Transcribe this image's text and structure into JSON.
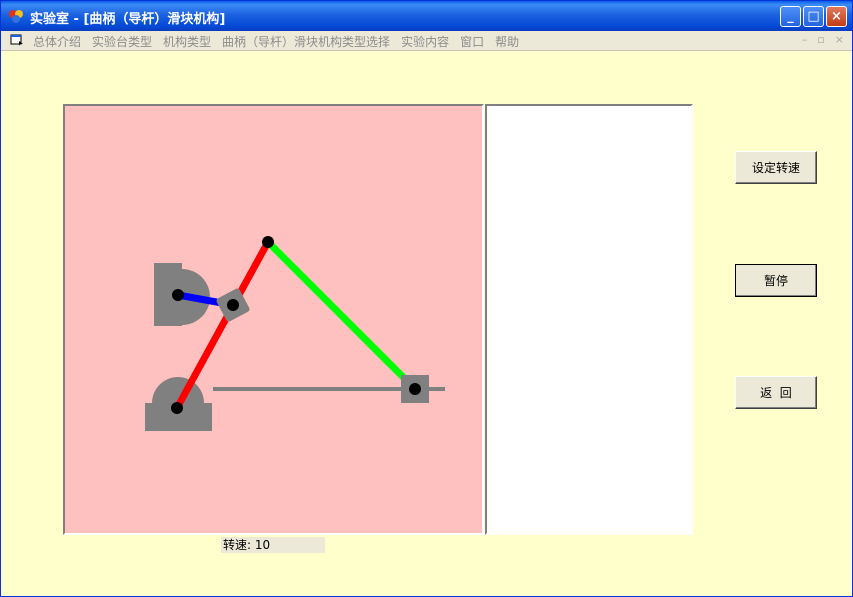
{
  "window": {
    "title": "实验室 - [曲柄（导杆）滑块机构]",
    "controls": {
      "minimize": "_",
      "maximize": "□",
      "close": "×"
    }
  },
  "menubar": {
    "items": [
      "总体介绍",
      "实验台类型",
      "机构类型",
      "曲柄（导杆）滑块机构类型选择",
      "实验内容",
      "窗口",
      "帮助"
    ],
    "mdi_controls": [
      "–",
      "▫",
      "×"
    ]
  },
  "status": {
    "speed_label": "转速: 10"
  },
  "buttons": {
    "set_speed": "设定转速",
    "pause": "暂停",
    "return": "返  回"
  },
  "mechanism": {
    "colors": {
      "canvas_bg": "#ffc0c0",
      "support": "#808080",
      "crank": "#0000ff",
      "guide_bar": "#ff0000",
      "connecting_rod": "#00ff00",
      "rail": "#808080",
      "slider": "#808080",
      "joint": "#000000"
    }
  }
}
